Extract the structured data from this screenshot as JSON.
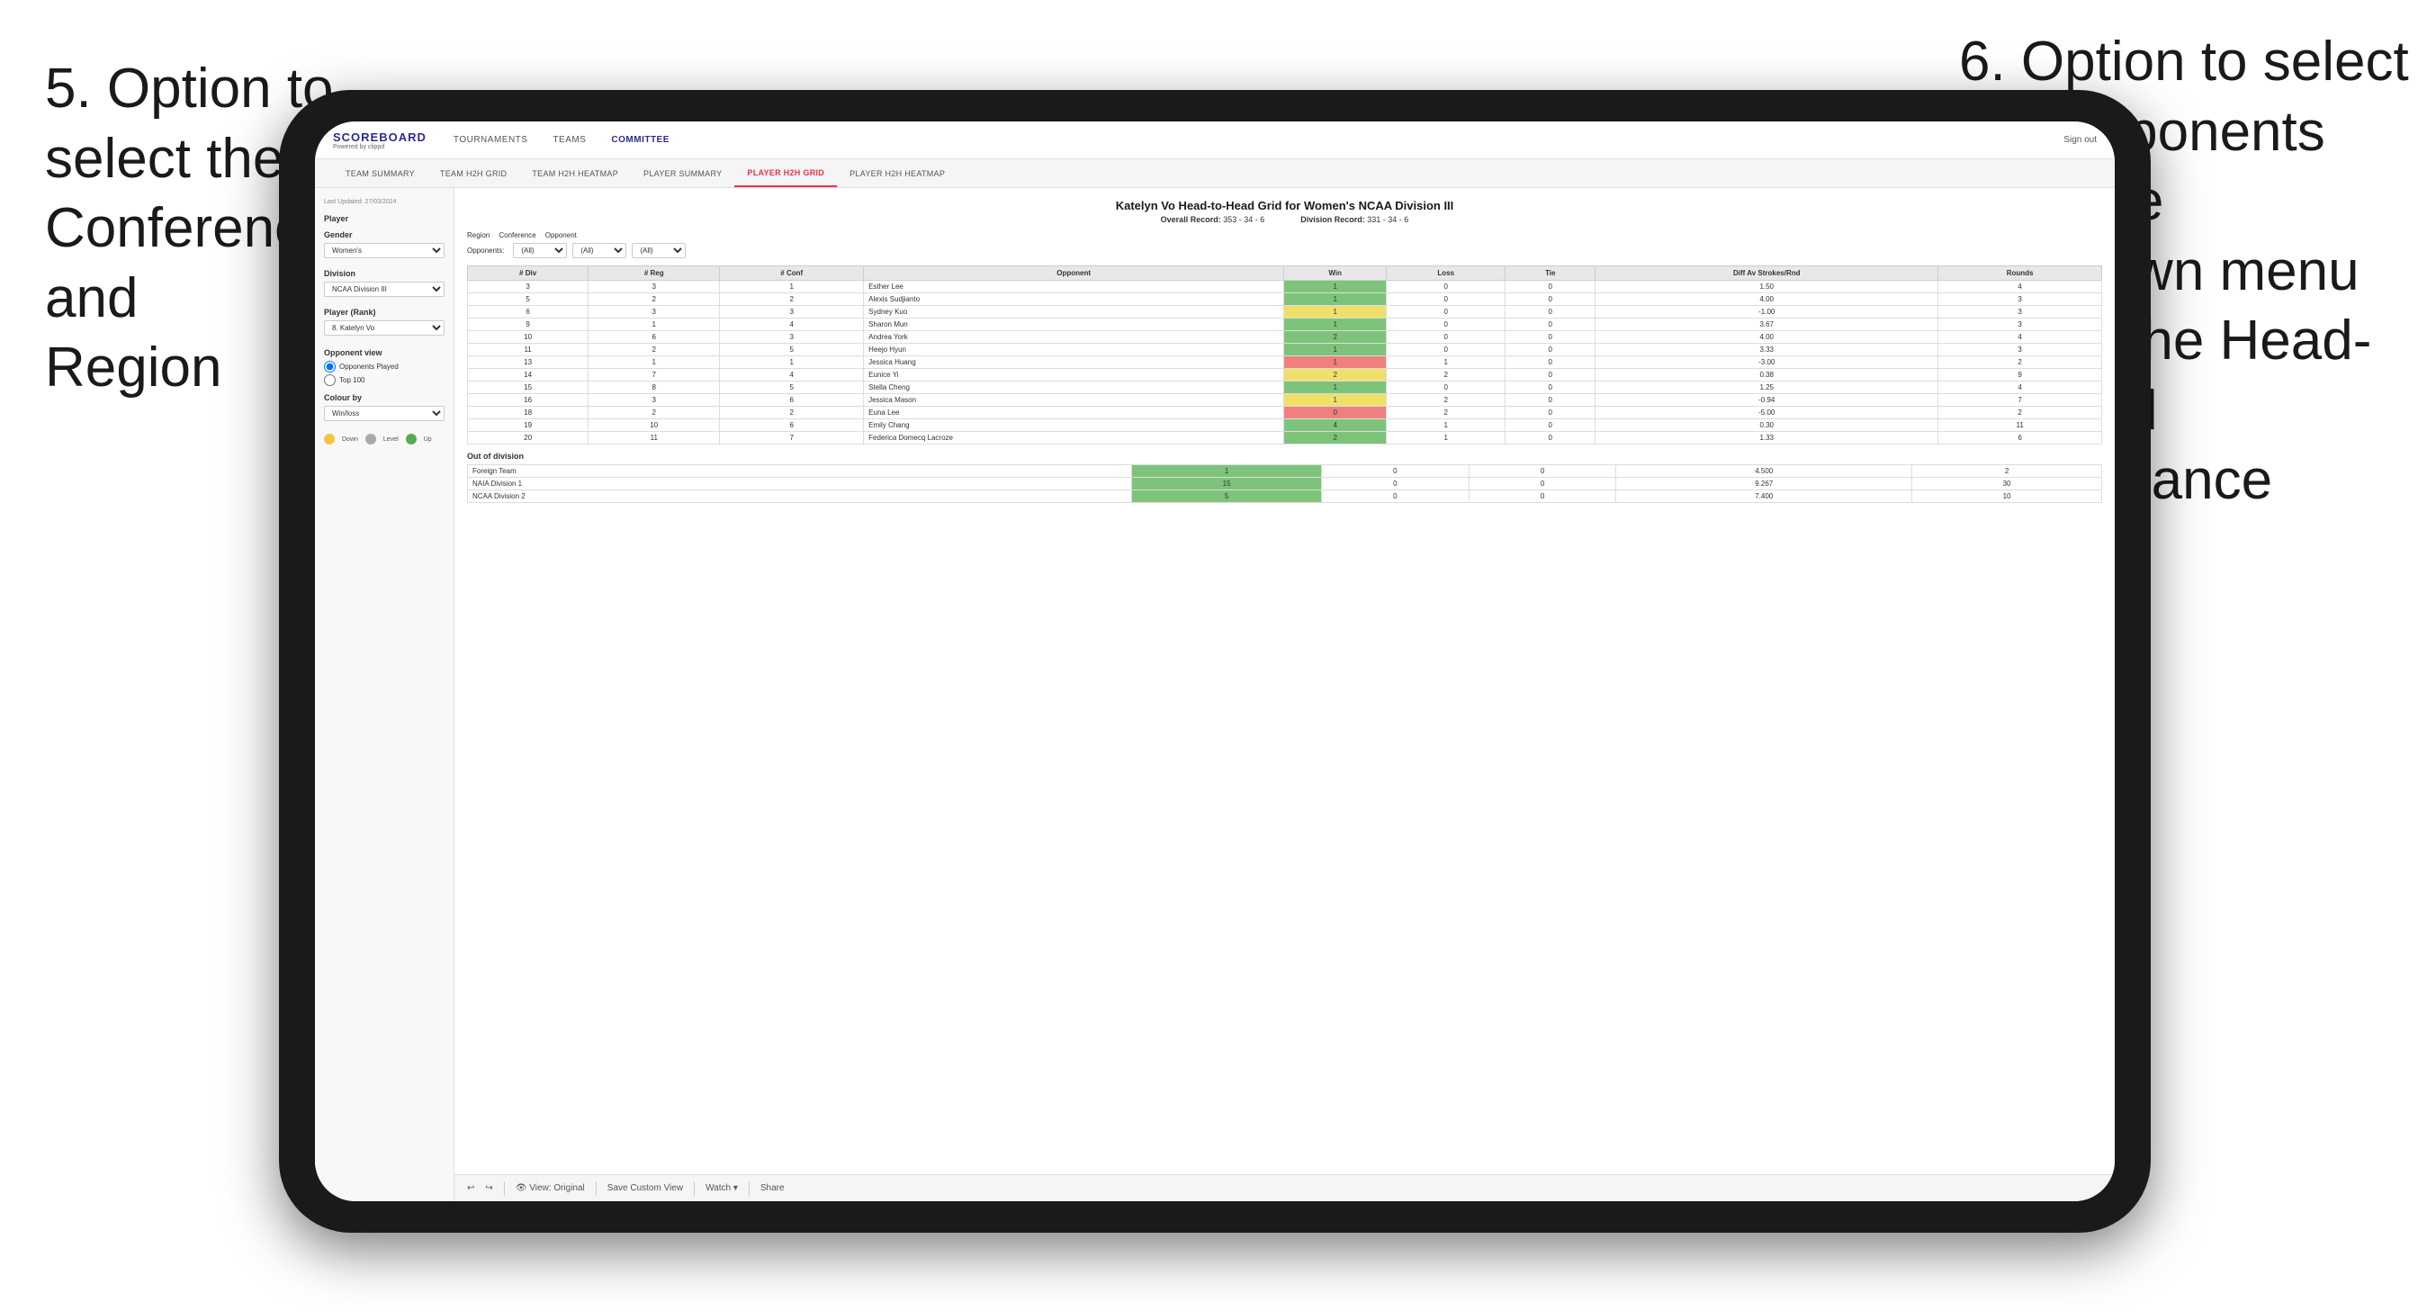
{
  "annotation_left": {
    "line1": "5. Option to",
    "line2": "select the",
    "line3": "Conference and",
    "line4": "Region"
  },
  "annotation_right": {
    "line1": "6. Option to select",
    "line2": "the Opponents",
    "line3": "from the",
    "line4": "dropdown menu",
    "line5": "to see the Head-",
    "line6": "to-Head",
    "line7": "performance"
  },
  "nav": {
    "logo": "SCOREBOARD",
    "logo_sub": "Powered by clippd",
    "items": [
      "TOURNAMENTS",
      "TEAMS",
      "COMMITTEE"
    ],
    "sign_out": "Sign out"
  },
  "sub_nav": {
    "items": [
      "TEAM SUMMARY",
      "TEAM H2H GRID",
      "TEAM H2H HEATMAP",
      "PLAYER SUMMARY",
      "PLAYER H2H GRID",
      "PLAYER H2H HEATMAP"
    ],
    "active": "PLAYER H2H GRID"
  },
  "sidebar": {
    "updated": "Last Updated: 27/03/2024",
    "player_label": "Player",
    "gender_label": "Gender",
    "gender_value": "Women's",
    "division_label": "Division",
    "division_value": "NCAA Division III",
    "player_rank_label": "Player (Rank)",
    "player_rank_value": "8. Katelyn Vo",
    "opponent_view_label": "Opponent view",
    "opponent_played": "Opponents Played",
    "top_100": "Top 100",
    "colour_by_label": "Colour by",
    "colour_by_value": "Win/loss",
    "legend_down": "Down",
    "legend_level": "Level",
    "legend_up": "Up"
  },
  "main": {
    "title": "Katelyn Vo Head-to-Head Grid for Women's NCAA Division III",
    "overall_record_label": "Overall Record:",
    "overall_record": "353 - 34 - 6",
    "division_record_label": "Division Record:",
    "division_record": "331 - 34 - 6",
    "region_label": "Region",
    "conference_label": "Conference",
    "opponent_label": "Opponent",
    "opponents_label": "Opponents:",
    "region_value": "(All)",
    "conference_value": "(All)",
    "opponent_value": "(All)",
    "table_headers": [
      "# Div",
      "# Reg",
      "# Conf",
      "Opponent",
      "Win",
      "Loss",
      "Tie",
      "Diff Av Strokes/Rnd",
      "Rounds"
    ],
    "rows": [
      {
        "div": "3",
        "reg": "3",
        "conf": "1",
        "opponent": "Esther Lee",
        "win": "1",
        "loss": "0",
        "tie": "0",
        "diff": "1.50",
        "rounds": "4",
        "win_color": "green",
        "loss_color": "",
        "tie_color": ""
      },
      {
        "div": "5",
        "reg": "2",
        "conf": "2",
        "opponent": "Alexis Sudjianto",
        "win": "1",
        "loss": "0",
        "tie": "0",
        "diff": "4.00",
        "rounds": "3",
        "win_color": "green"
      },
      {
        "div": "6",
        "reg": "3",
        "conf": "3",
        "opponent": "Sydney Kuo",
        "win": "1",
        "loss": "0",
        "tie": "0",
        "diff": "-1.00",
        "rounds": "3",
        "win_color": "yellow"
      },
      {
        "div": "9",
        "reg": "1",
        "conf": "4",
        "opponent": "Sharon Mun",
        "win": "1",
        "loss": "0",
        "tie": "0",
        "diff": "3.67",
        "rounds": "3",
        "win_color": "green"
      },
      {
        "div": "10",
        "reg": "6",
        "conf": "3",
        "opponent": "Andrea York",
        "win": "2",
        "loss": "0",
        "tie": "0",
        "diff": "4.00",
        "rounds": "4",
        "win_color": "green"
      },
      {
        "div": "11",
        "reg": "2",
        "conf": "5",
        "opponent": "Heejo Hyun",
        "win": "1",
        "loss": "0",
        "tie": "0",
        "diff": "3.33",
        "rounds": "3",
        "win_color": "green"
      },
      {
        "div": "13",
        "reg": "1",
        "conf": "1",
        "opponent": "Jessica Huang",
        "win": "1",
        "loss": "1",
        "tie": "0",
        "diff": "-3.00",
        "rounds": "2",
        "win_color": "red"
      },
      {
        "div": "14",
        "reg": "7",
        "conf": "4",
        "opponent": "Eunice Yi",
        "win": "2",
        "loss": "2",
        "tie": "0",
        "diff": "0.38",
        "rounds": "9",
        "win_color": "yellow"
      },
      {
        "div": "15",
        "reg": "8",
        "conf": "5",
        "opponent": "Stella Cheng",
        "win": "1",
        "loss": "0",
        "tie": "0",
        "diff": "1.25",
        "rounds": "4",
        "win_color": "green"
      },
      {
        "div": "16",
        "reg": "3",
        "conf": "6",
        "opponent": "Jessica Mason",
        "win": "1",
        "loss": "2",
        "tie": "0",
        "diff": "-0.94",
        "rounds": "7",
        "win_color": "yellow"
      },
      {
        "div": "18",
        "reg": "2",
        "conf": "2",
        "opponent": "Euna Lee",
        "win": "0",
        "loss": "2",
        "tie": "0",
        "diff": "-5.00",
        "rounds": "2",
        "win_color": "red"
      },
      {
        "div": "19",
        "reg": "10",
        "conf": "6",
        "opponent": "Emily Chang",
        "win": "4",
        "loss": "1",
        "tie": "0",
        "diff": "0.30",
        "rounds": "11",
        "win_color": "green"
      },
      {
        "div": "20",
        "reg": "11",
        "conf": "7",
        "opponent": "Federica Domecq Lacroze",
        "win": "2",
        "loss": "1",
        "tie": "0",
        "diff": "1.33",
        "rounds": "6",
        "win_color": "green"
      }
    ],
    "out_of_division_title": "Out of division",
    "out_rows": [
      {
        "name": "Foreign Team",
        "win": "1",
        "loss": "0",
        "tie": "0",
        "diff": "4.500",
        "rounds": "2",
        "win_color": "green"
      },
      {
        "name": "NAIA Division 1",
        "win": "15",
        "loss": "0",
        "tie": "0",
        "diff": "9.267",
        "rounds": "30",
        "win_color": "green"
      },
      {
        "name": "NCAA Division 2",
        "win": "5",
        "loss": "0",
        "tie": "0",
        "diff": "7.400",
        "rounds": "10",
        "win_color": "green"
      }
    ],
    "toolbar": {
      "view_original": "View: Original",
      "save_custom": "Save Custom View",
      "watch": "Watch",
      "share": "Share"
    }
  }
}
